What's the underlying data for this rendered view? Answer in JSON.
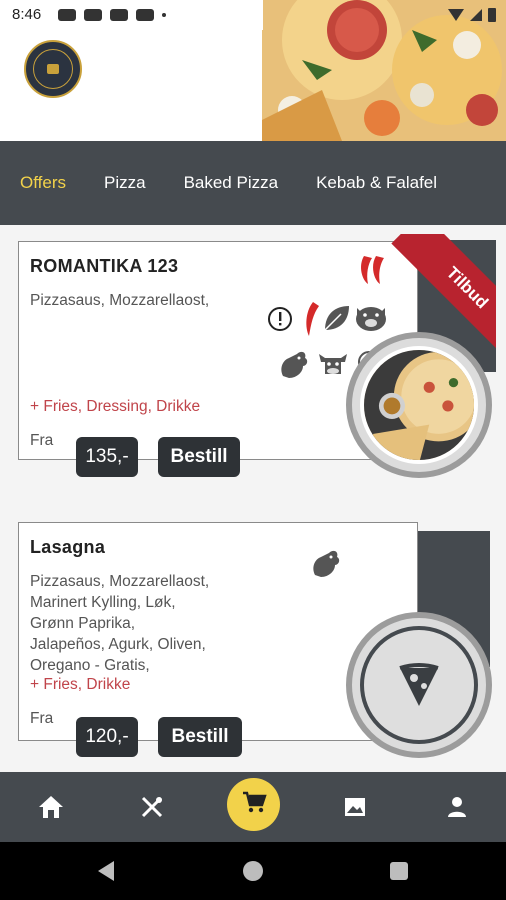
{
  "status_bar": {
    "time": "8:46",
    "icons": [
      "youtube-icon",
      "youtube-icon",
      "youtube-icon",
      "youtube-icon",
      "dot-icon",
      "wifi-icon",
      "signal-icon",
      "battery-icon"
    ]
  },
  "header": {
    "logo_icon": "restaurant-logo-icon",
    "hero_image": "pizza-photo"
  },
  "tabs": [
    {
      "label": "Offers",
      "active": true
    },
    {
      "label": "Pizza",
      "active": false
    },
    {
      "label": "Baked Pizza",
      "active": false
    },
    {
      "label": "Kebab & Falafel",
      "active": false
    }
  ],
  "items": [
    {
      "title": "ROMANTIKA 123",
      "description": "Pizzasaus, Mozzarellaost,",
      "extras": "+ Fries, Dressing, Drikke",
      "from_label": "Fra",
      "price": "135,-",
      "order_label": "Bestill",
      "badge": "Tilbud",
      "icons": [
        "chili-icon",
        "info-icon",
        "chili-icon",
        "leaf-icon",
        "pig-icon",
        "chicken-icon",
        "cow-icon",
        "lamb-icon"
      ],
      "image": "pizza-meal-photo"
    },
    {
      "title": "Lasagna",
      "description_lines": [
        "Pizzasaus, Mozzarellaost,",
        "Marinert Kylling, Løk,",
        "Grønn Paprika,",
        "Jalapeños, Agurk, Oliven,",
        "Oregano - Gratis,"
      ],
      "extras": "+ Fries, Drikke",
      "from_label": "Fra",
      "price": "120,-",
      "order_label": "Bestill",
      "icons": [
        "chicken-icon"
      ],
      "image": "pizza-slice-placeholder-icon"
    }
  ],
  "bottom_nav": [
    {
      "icon": "home-icon"
    },
    {
      "icon": "restaurant-menu-icon"
    },
    {
      "icon": "cart-icon"
    },
    {
      "icon": "gallery-icon"
    },
    {
      "icon": "profile-icon"
    }
  ],
  "colors": {
    "accent": "#f2d24a",
    "dark": "#454a4f",
    "button": "#2e3236",
    "extras": "#c0444a",
    "ribbon": "#b8232f"
  }
}
